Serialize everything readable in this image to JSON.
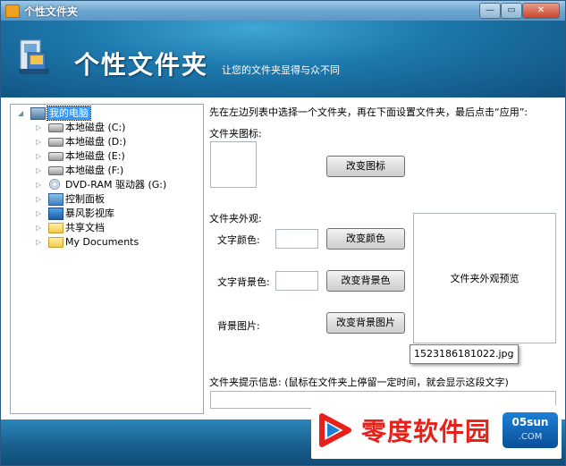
{
  "window": {
    "title": "个性文件夹",
    "minimize_glyph": "—",
    "maximize_glyph": "▭",
    "close_glyph": "✕"
  },
  "banner": {
    "title": "个性文件夹",
    "subtitle": "让您的文件夹显得与众不同"
  },
  "tree": {
    "root_label": "我的电脑",
    "items": [
      {
        "label": "本地磁盘 (C:)",
        "icon": "drive-icon"
      },
      {
        "label": "本地磁盘 (D:)",
        "icon": "drive-icon"
      },
      {
        "label": "本地磁盘 (E:)",
        "icon": "drive-icon"
      },
      {
        "label": "本地磁盘 (F:)",
        "icon": "drive-icon"
      },
      {
        "label": "DVD-RAM 驱动器 (G:)",
        "icon": "dvd-drive-icon"
      },
      {
        "label": "控制面板",
        "icon": "control-panel-icon"
      },
      {
        "label": "暴风影视库",
        "icon": "media-library-icon"
      },
      {
        "label": "共享文档",
        "icon": "folder-icon"
      },
      {
        "label": "My Documents",
        "icon": "folder-icon"
      }
    ]
  },
  "settings": {
    "instruction": "先在左边列表中选择一个文件夹，再在下面设置文件夹，最后点击“应用”:",
    "icon_section_label": "文件夹图标:",
    "change_icon_label": "改变图标",
    "appearance_label": "文件夹外观:",
    "text_color_label": "文字颜色:",
    "change_color_label": "改变颜色",
    "text_bg_label": "文字背景色:",
    "change_bg_color_label": "改变背景色",
    "bg_image_label": "背景图片:",
    "change_bg_image_label": "改变背景图片",
    "preview_label": "文件夹外观预览",
    "tooltip": "1523186181022.jpg",
    "hint_label": "文件夹提示信息: (鼠标在文件夹上停留一定时间，就会显示这段文字)",
    "hint_value": ""
  },
  "watermark": {
    "text": "零度软件园",
    "badge_top": "05sun",
    "badge_bottom": ".COM"
  },
  "colors": {
    "banner": "#1e79ad",
    "selection": "#3399ff",
    "footer": "#175e8d"
  }
}
